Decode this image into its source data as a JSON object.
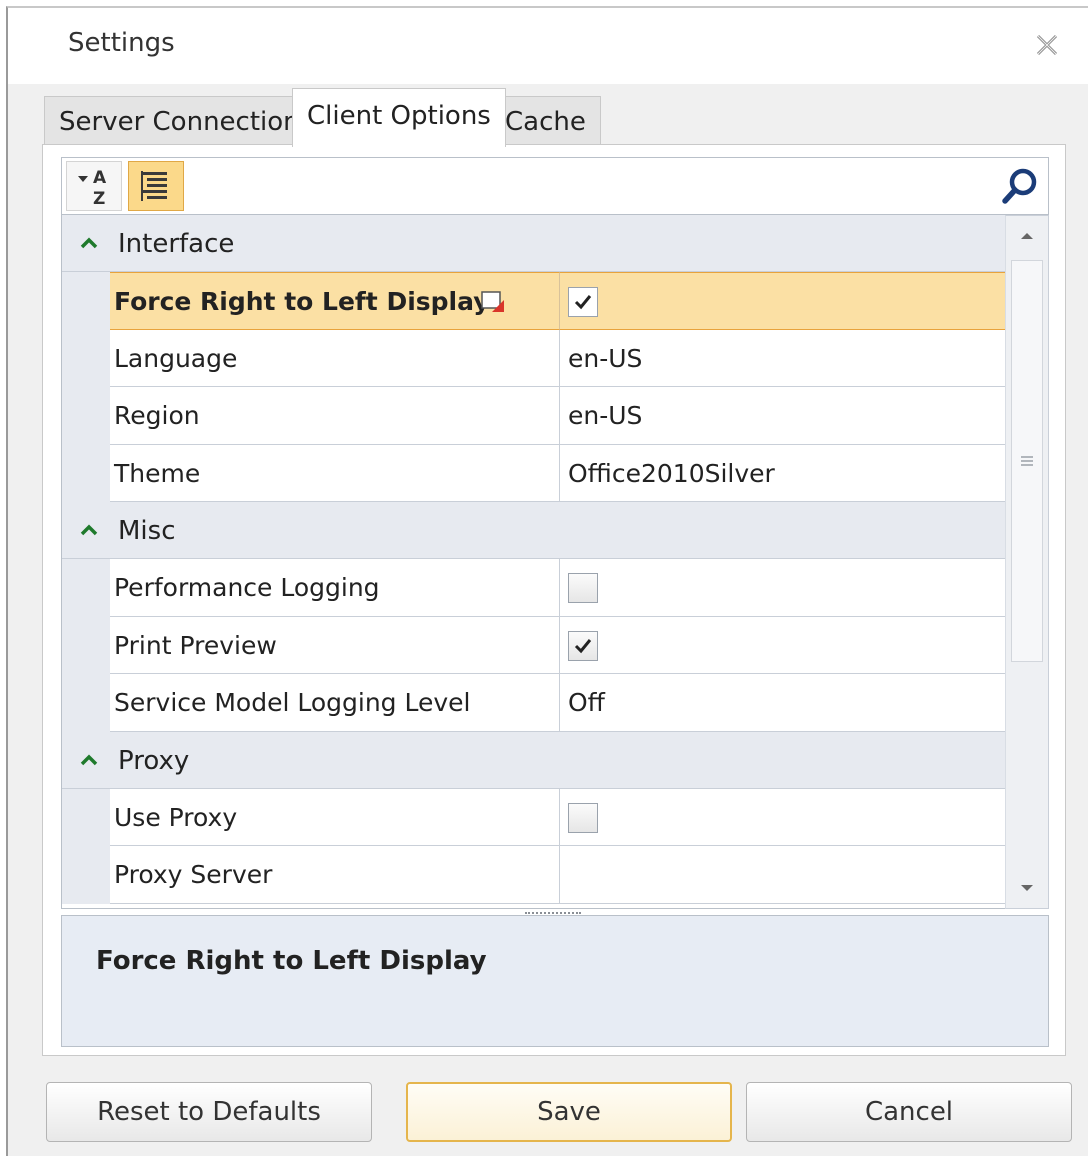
{
  "window": {
    "title": "Settings"
  },
  "tabs": [
    {
      "label": "Server Connection",
      "active": false
    },
    {
      "label": "Client Options",
      "active": true
    },
    {
      "label": "Cache",
      "active": false
    }
  ],
  "toolbar": {
    "sort_alpha_icon": "sort-alphabetical-icon",
    "categorized_icon": "categorized-list-icon",
    "search_placeholder": "",
    "search_icon": "search-icon"
  },
  "grid": {
    "categories": [
      {
        "name": "Interface",
        "expanded": true,
        "properties": [
          {
            "name": "Force Right to Left Display",
            "type": "checkbox",
            "checked": true,
            "selected": true
          },
          {
            "name": "Language",
            "type": "text",
            "value": "en-US"
          },
          {
            "name": "Region",
            "type": "text",
            "value": "en-US"
          },
          {
            "name": "Theme",
            "type": "text",
            "value": "Office2010Silver"
          }
        ]
      },
      {
        "name": "Misc",
        "expanded": true,
        "properties": [
          {
            "name": "Performance Logging",
            "type": "checkbox",
            "checked": false
          },
          {
            "name": "Print Preview",
            "type": "checkbox",
            "checked": true
          },
          {
            "name": "Service Model Logging Level",
            "type": "text",
            "value": "Off"
          }
        ]
      },
      {
        "name": "Proxy",
        "expanded": true,
        "properties": [
          {
            "name": "Use Proxy",
            "type": "checkbox",
            "checked": false
          },
          {
            "name": "Proxy Server",
            "type": "text",
            "value": ""
          }
        ]
      }
    ]
  },
  "description": {
    "title": "Force Right to Left Display"
  },
  "buttons": {
    "reset": "Reset to Defaults",
    "save": "Save",
    "cancel": "Cancel"
  },
  "colors": {
    "selected_row": "#fbe0a4",
    "selected_border": "#e8a33c",
    "category_bg": "#e7eaf0",
    "description_bg": "#e7ecf4"
  }
}
